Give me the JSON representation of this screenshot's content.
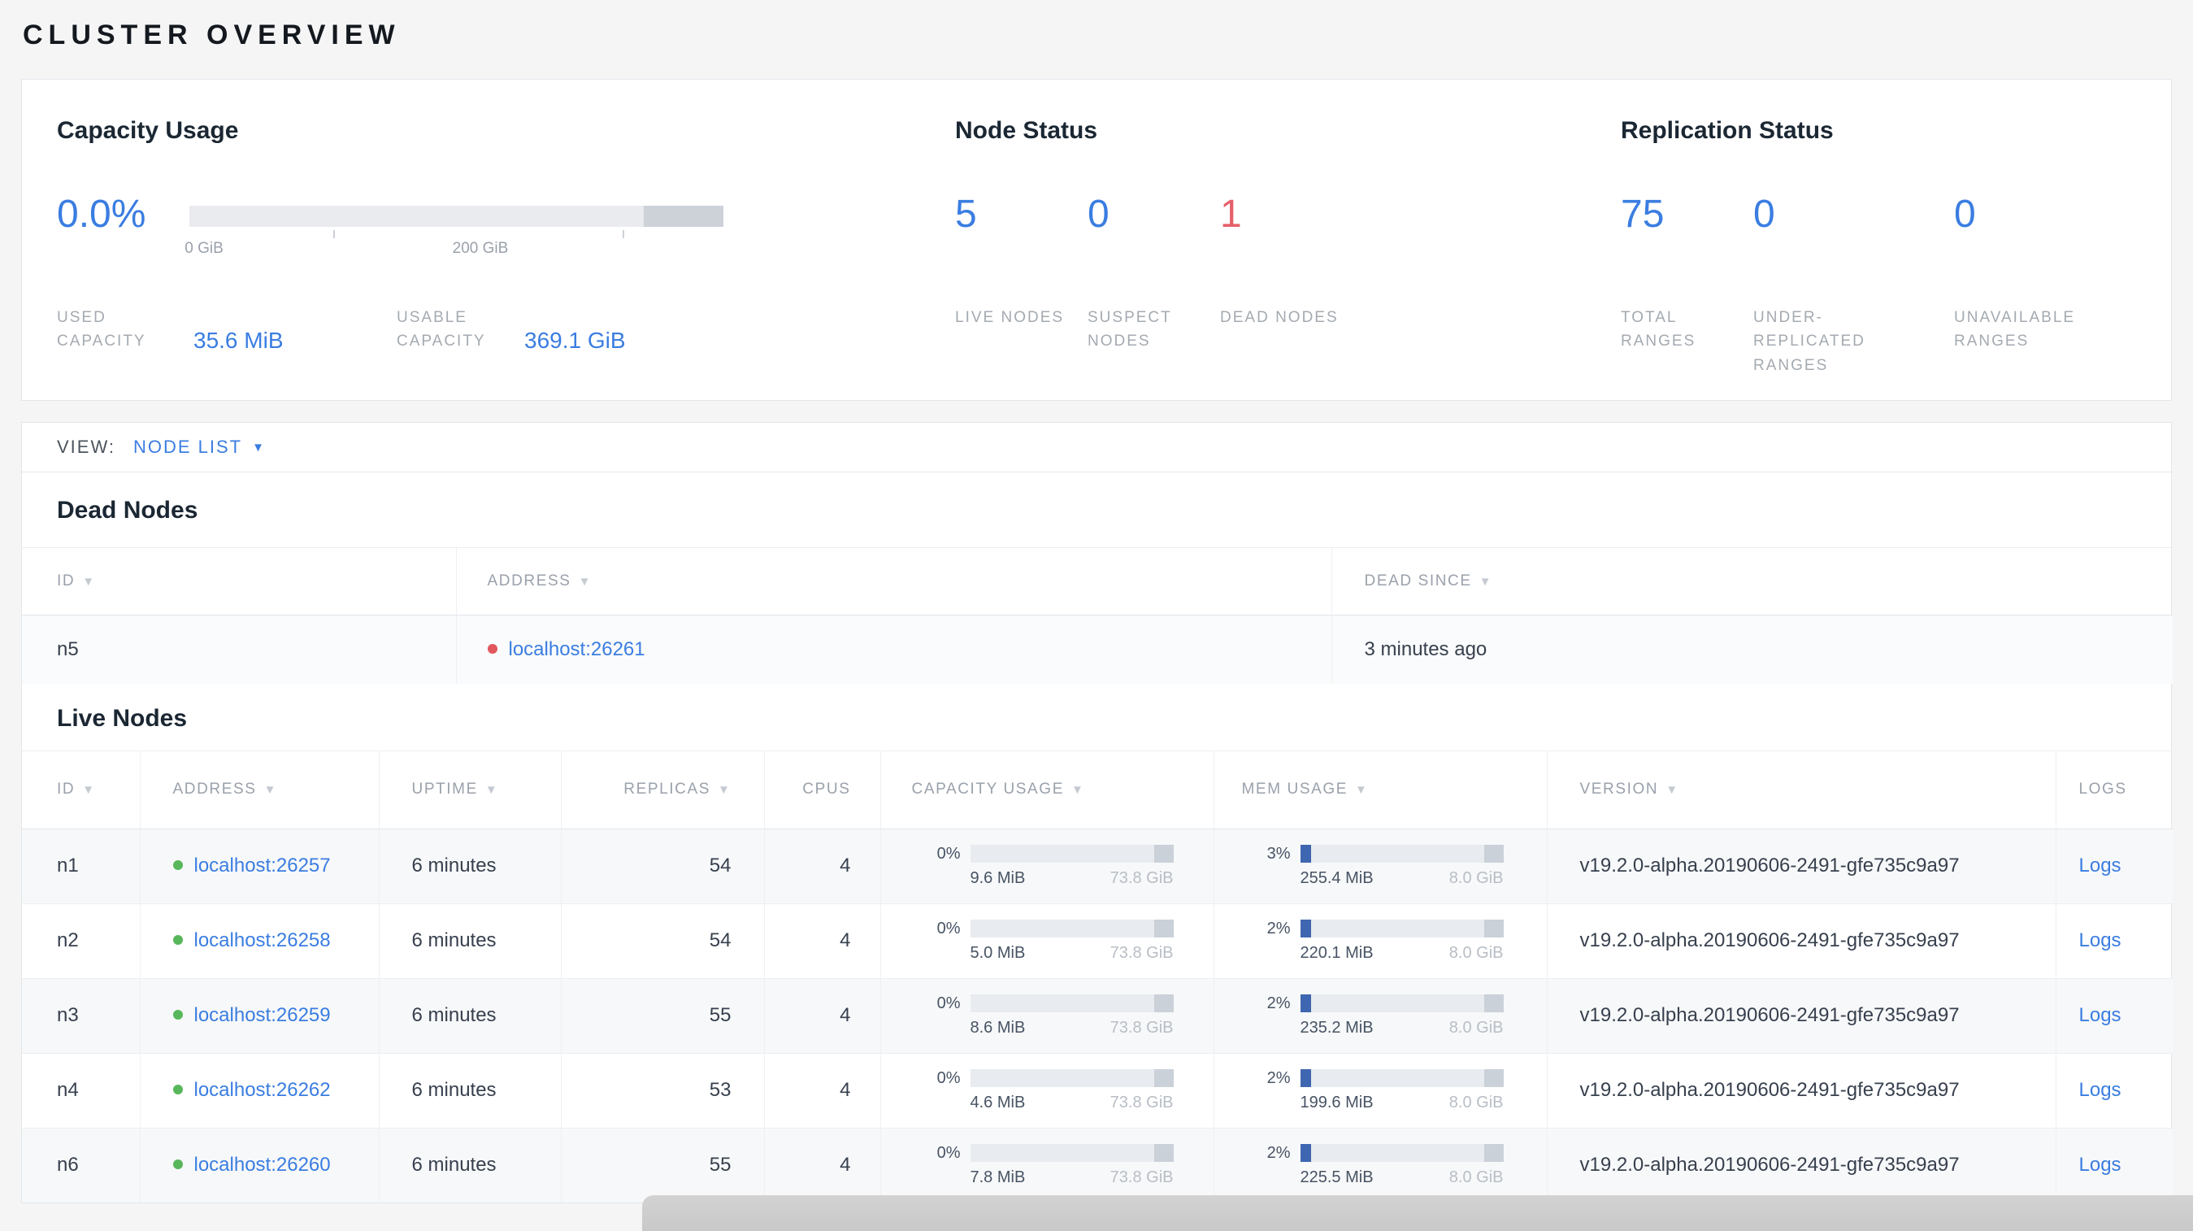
{
  "colors": {
    "accent_blue": "#3a7de1",
    "danger_red": "#e5606b",
    "live_green": "#58b75b",
    "dead_red_dot": "#e2575d",
    "bar_track": "#e8ebef",
    "bar_dark_segment": "#cbd1d9",
    "mem_fill_blue": "#3f66b0"
  },
  "page": {
    "title": "CLUSTER OVERVIEW"
  },
  "summary": {
    "capacity": {
      "title": "Capacity Usage",
      "percent": "0.0%",
      "tick_labels": [
        "0 GiB",
        "200 GiB"
      ],
      "used": {
        "label": "USED CAPACITY",
        "value": "35.6 MiB"
      },
      "usable": {
        "label": "USABLE CAPACITY",
        "value": "369.1 GiB"
      }
    },
    "node_status": {
      "title": "Node Status",
      "stats": [
        {
          "value": "5",
          "label": "LIVE NODES"
        },
        {
          "value": "0",
          "label": "SUSPECT NODES"
        },
        {
          "value": "1",
          "label": "DEAD NODES"
        }
      ]
    },
    "replication": {
      "title": "Replication Status",
      "stats": [
        {
          "value": "75",
          "label": "TOTAL RANGES"
        },
        {
          "value": "0",
          "label": "UNDER-REPLICATED RANGES"
        },
        {
          "value": "0",
          "label": "UNAVAILABLE RANGES"
        }
      ]
    }
  },
  "view_bar": {
    "label": "VIEW:",
    "selected": "NODE LIST"
  },
  "dead_nodes": {
    "title": "Dead Nodes",
    "columns": {
      "id": "ID",
      "address": "ADDRESS",
      "dead_since": "DEAD SINCE"
    },
    "rows": [
      {
        "id": "n5",
        "address": "localhost:26261",
        "dead_since": "3 minutes ago"
      }
    ]
  },
  "live_nodes": {
    "title": "Live Nodes",
    "columns": {
      "id": "ID",
      "address": "ADDRESS",
      "uptime": "UPTIME",
      "replicas": "REPLICAS",
      "cpus": "CPUS",
      "capacity": "CAPACITY USAGE",
      "mem": "MEM USAGE",
      "version": "VERSION",
      "logs": "LOGS"
    },
    "rows": [
      {
        "id": "n1",
        "address": "localhost:26257",
        "uptime": "6 minutes",
        "replicas": "54",
        "cpus": "4",
        "capacity_pct": "0%",
        "capacity_used": "9.6 MiB",
        "capacity_total": "73.8 GiB",
        "mem_pct": "3%",
        "mem_used": "255.4 MiB",
        "mem_total": "8.0 GiB",
        "version": "v19.2.0-alpha.20190606-2491-gfe735c9a97",
        "logs_label": "Logs"
      },
      {
        "id": "n2",
        "address": "localhost:26258",
        "uptime": "6 minutes",
        "replicas": "54",
        "cpus": "4",
        "capacity_pct": "0%",
        "capacity_used": "5.0 MiB",
        "capacity_total": "73.8 GiB",
        "mem_pct": "2%",
        "mem_used": "220.1 MiB",
        "mem_total": "8.0 GiB",
        "version": "v19.2.0-alpha.20190606-2491-gfe735c9a97",
        "logs_label": "Logs"
      },
      {
        "id": "n3",
        "address": "localhost:26259",
        "uptime": "6 minutes",
        "replicas": "55",
        "cpus": "4",
        "capacity_pct": "0%",
        "capacity_used": "8.6 MiB",
        "capacity_total": "73.8 GiB",
        "mem_pct": "2%",
        "mem_used": "235.2 MiB",
        "mem_total": "8.0 GiB",
        "version": "v19.2.0-alpha.20190606-2491-gfe735c9a97",
        "logs_label": "Logs"
      },
      {
        "id": "n4",
        "address": "localhost:26262",
        "uptime": "6 minutes",
        "replicas": "53",
        "cpus": "4",
        "capacity_pct": "0%",
        "capacity_used": "4.6 MiB",
        "capacity_total": "73.8 GiB",
        "mem_pct": "2%",
        "mem_used": "199.6 MiB",
        "mem_total": "8.0 GiB",
        "version": "v19.2.0-alpha.20190606-2491-gfe735c9a97",
        "logs_label": "Logs"
      },
      {
        "id": "n6",
        "address": "localhost:26260",
        "uptime": "6 minutes",
        "replicas": "55",
        "cpus": "4",
        "capacity_pct": "0%",
        "capacity_used": "7.8 MiB",
        "capacity_total": "73.8 GiB",
        "mem_pct": "2%",
        "mem_used": "225.5 MiB",
        "mem_total": "8.0 GiB",
        "version": "v19.2.0-alpha.20190606-2491-gfe735c9a97",
        "logs_label": "Logs"
      }
    ]
  }
}
